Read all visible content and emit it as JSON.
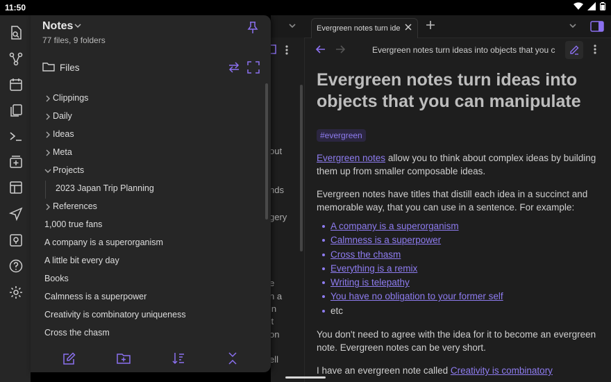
{
  "status": {
    "time": "11:50"
  },
  "vault": {
    "name": "Notes",
    "summary": "77 files, 9 folders"
  },
  "files_header": {
    "label": "Files"
  },
  "tree": [
    {
      "label": "Clippings",
      "type": "folder",
      "expanded": false
    },
    {
      "label": "Daily",
      "type": "folder",
      "expanded": false
    },
    {
      "label": "Ideas",
      "type": "folder",
      "expanded": false
    },
    {
      "label": "Meta",
      "type": "folder",
      "expanded": false
    },
    {
      "label": "Projects",
      "type": "folder",
      "expanded": true
    },
    {
      "label": "2023 Japan Trip Planning",
      "type": "file",
      "child": true
    },
    {
      "label": "References",
      "type": "folder",
      "expanded": false
    },
    {
      "label": "1,000 true fans",
      "type": "file"
    },
    {
      "label": "A company is a superorganism",
      "type": "file"
    },
    {
      "label": "A little bit every day",
      "type": "file"
    },
    {
      "label": "Books",
      "type": "file"
    },
    {
      "label": "Calmness is a superpower",
      "type": "file"
    },
    {
      "label": "Creativity is combinatory uniqueness",
      "type": "file"
    },
    {
      "label": "Cross the chasm",
      "type": "file"
    }
  ],
  "tab": {
    "title": "Evergreen notes turn ideas"
  },
  "note": {
    "nav_title": "Evergreen notes turn ideas into objects that you c",
    "heading": "Evergreen notes turn ideas into objects that you can manipulate",
    "tag": "#evergreen",
    "p1_link": "Evergreen notes",
    "p1_rest": " allow you to think about complex ideas by building them up from smaller composable ideas.",
    "p2": "Evergreen notes have titles that distill each idea in a succinct and memorable way, that you can use in a sentence. For example:",
    "list": [
      "A company is a superorganism",
      "Calmness is a superpower",
      "Cross the chasm",
      "Everything is a remix",
      "Writing is telepathy",
      "You have no obligation to your former self"
    ],
    "list_tail": "etc",
    "p3": "You don't need to agree with the idea for it to become an evergreen note. Evergreen notes can be very short.",
    "p4_start": "I have an evergreen note called ",
    "p4_link": "Creativity is combinatory"
  },
  "behind": {
    "fragments": [
      "out",
      "nds",
      "gery",
      "e",
      "n a",
      "in",
      "'t",
      "on",
      "ell",
      "ever"
    ]
  },
  "colors": {
    "accent": "#8b70f0",
    "drawer_bg": "#262626",
    "editor_bg": "#1e1e1e"
  },
  "icons": {
    "rail": [
      "open-file-icon",
      "graph-icon",
      "calendar-icon",
      "copy-icon",
      "terminal-icon",
      "add-card-icon",
      "layout-icon",
      "send-icon",
      "help-box-icon",
      "help-circle-icon",
      "settings-icon"
    ],
    "bottom": [
      "new-note-icon",
      "new-folder-icon",
      "sort-icon",
      "collapse-icon"
    ]
  }
}
